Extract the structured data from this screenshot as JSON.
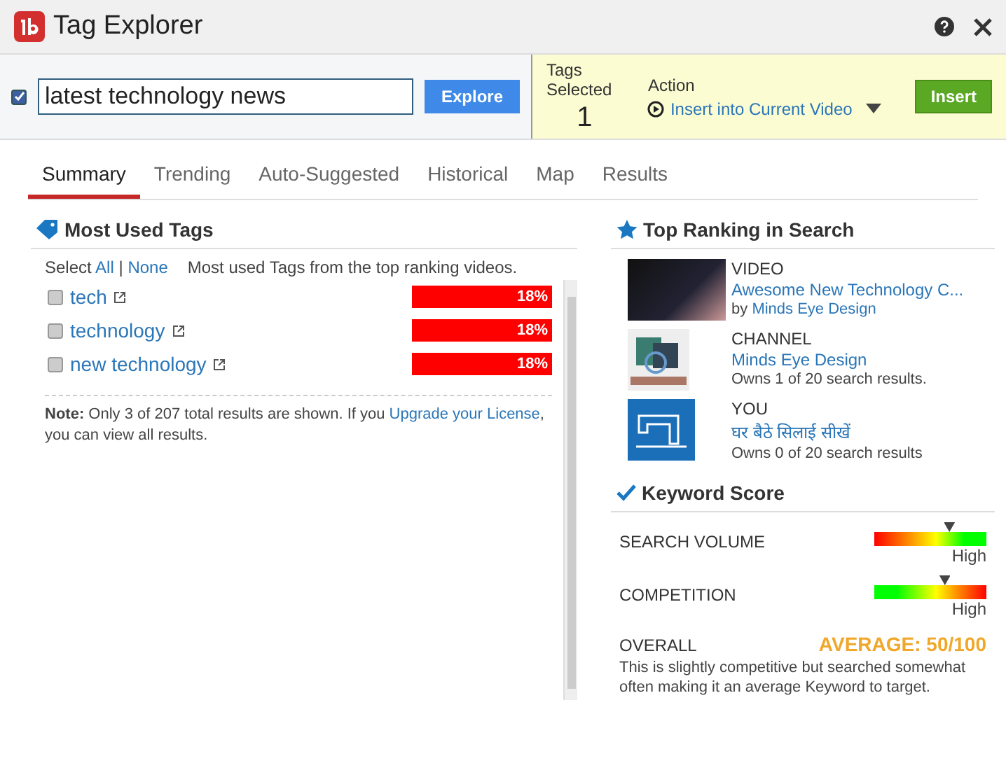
{
  "window": {
    "title": "Tag Explorer"
  },
  "search": {
    "checked": true,
    "value": "latest technology news",
    "button": "Explore"
  },
  "selection": {
    "label": "Tags Selected",
    "count": "1",
    "action_label": "Action",
    "action": "Insert into Current Video",
    "button": "Insert"
  },
  "tabs": [
    {
      "label": "Summary",
      "selected": true
    },
    {
      "label": "Trending",
      "selected": false
    },
    {
      "label": "Auto-Suggested",
      "selected": false
    },
    {
      "label": "Historical",
      "selected": false
    },
    {
      "label": "Map",
      "selected": false
    },
    {
      "label": "Results",
      "selected": false
    }
  ],
  "most_used": {
    "title": "Most Used Tags",
    "select_label": "Select",
    "all": "All",
    "separator": "|",
    "none": "None",
    "description": "Most used Tags from the top ranking videos.",
    "tags": [
      {
        "name": "tech",
        "checked": false,
        "percent": "18%"
      },
      {
        "name": "technology",
        "checked": false,
        "percent": "18%"
      },
      {
        "name": "new technology",
        "checked": false,
        "percent": "18%"
      }
    ],
    "note_label": "Note:",
    "note": "Only 3 of 207 total results are shown. If you",
    "note_link": "Upgrade your License",
    "note_end": ", you can view all results."
  },
  "top_ranking": {
    "title": "Top Ranking in Search",
    "items": [
      {
        "kind": "video",
        "type": "VIDEO",
        "title": "Awesome New Technology C...",
        "by": "by",
        "author": "Minds Eye Design"
      },
      {
        "kind": "channel",
        "type": "CHANNEL",
        "title": "Minds Eye Design",
        "detail": "Owns 1 of 20 search results."
      },
      {
        "kind": "you",
        "type": "YOU",
        "title": "घर बैठे सिलाई सीखें",
        "detail": "Owns 0 of 20 search results"
      }
    ]
  },
  "keyword_score": {
    "title": "Keyword Score",
    "metrics": [
      {
        "label": "SEARCH VOLUME",
        "kind": "rising",
        "level": 0.67,
        "reading": "High"
      },
      {
        "label": "COMPETITION",
        "kind": "falling",
        "level": 0.63,
        "reading": "High"
      }
    ],
    "overall_label": "OVERALL",
    "overall": "AVERAGE: 50/100",
    "summary": "This is slightly competitive but searched somewhat often making it an average Keyword to target."
  }
}
